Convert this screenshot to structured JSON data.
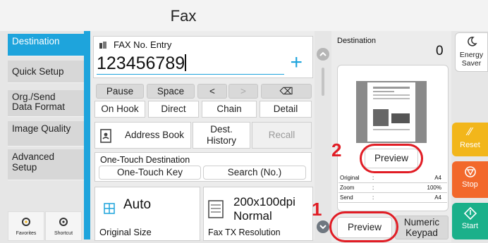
{
  "header": {
    "title": "Fax"
  },
  "sidebar": {
    "items": [
      {
        "label": "Destination",
        "active": true
      },
      {
        "label": "Quick Setup"
      },
      {
        "label": "Org./Send\nData Format"
      },
      {
        "label": "Image Quality"
      },
      {
        "label": "Advanced\nSetup"
      }
    ],
    "shortcuts": [
      {
        "label": "Favorites",
        "icon": "star-gear-icon"
      },
      {
        "label": "Shortcut",
        "icon": "gear-icon"
      }
    ]
  },
  "fax_entry": {
    "label": "FAX No. Entry",
    "value": "123456789",
    "plus": "+"
  },
  "keys_row1": [
    "Pause",
    "Space",
    "<",
    ">",
    "⌫"
  ],
  "keys_row2": [
    "On Hook",
    "Direct",
    "Chain",
    "Detail"
  ],
  "address_row": {
    "address_book": "Address Book",
    "dest_history": "Dest.\nHistory",
    "recall": "Recall"
  },
  "one_touch": {
    "label": "One-Touch Destination",
    "key": "One-Touch Key",
    "search": "Search (No.)"
  },
  "original_size": {
    "value": "Auto",
    "label": "Original Size"
  },
  "resolution": {
    "value": "200x100dpi\nNormal",
    "label": "Fax TX Resolution"
  },
  "destination_panel": {
    "label": "Destination",
    "count": "0",
    "preview_label": "Preview",
    "info": [
      {
        "key": "Original",
        "sep": ":",
        "value": "A4"
      },
      {
        "key": "Zoom",
        "sep": ":",
        "value": "100%"
      },
      {
        "key": "Send",
        "sep": ":",
        "value": "A4"
      }
    ]
  },
  "bottom_buttons": {
    "preview": "Preview",
    "numeric_keypad": "Numeric\nKeypad"
  },
  "right_buttons": {
    "energy_saver": "Energy\nSaver",
    "reset": "Reset",
    "stop": "Stop",
    "start": "Start"
  },
  "callouts": {
    "one": "1",
    "two": "2"
  },
  "colors": {
    "accent_blue": "#1ea4dc",
    "reset": "#f2b61b",
    "stop": "#f2682b",
    "start": "#1bb08a",
    "callout_red": "#e11d25"
  }
}
